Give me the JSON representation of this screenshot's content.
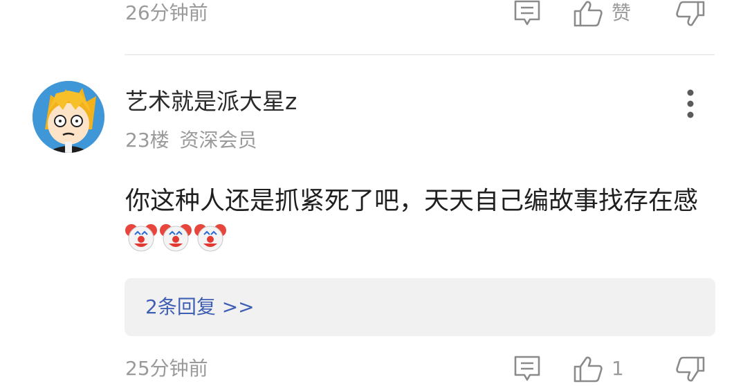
{
  "prev_comment": {
    "time": "26分钟前",
    "like_label": "赞"
  },
  "comment": {
    "username": "艺术就是派大星z",
    "floor": "23楼",
    "badge": "资深会员",
    "text": "你这种人还是抓紧死了吧，天天自己编故事找存在感",
    "emojis": [
      "clown-emoji",
      "clown-emoji",
      "clown-emoji"
    ],
    "reply_link": "2条回复 >>",
    "time": "25分钟前",
    "like_count": "1"
  },
  "icons": {
    "comment": "comment-icon",
    "like": "thumbs-up-icon",
    "dislike": "thumbs-down-icon",
    "more": "more-vertical-icon"
  },
  "colors": {
    "link": "#3f5fb5",
    "secondary_text": "#9a9a9a",
    "reply_bg": "#f1f1f1"
  }
}
